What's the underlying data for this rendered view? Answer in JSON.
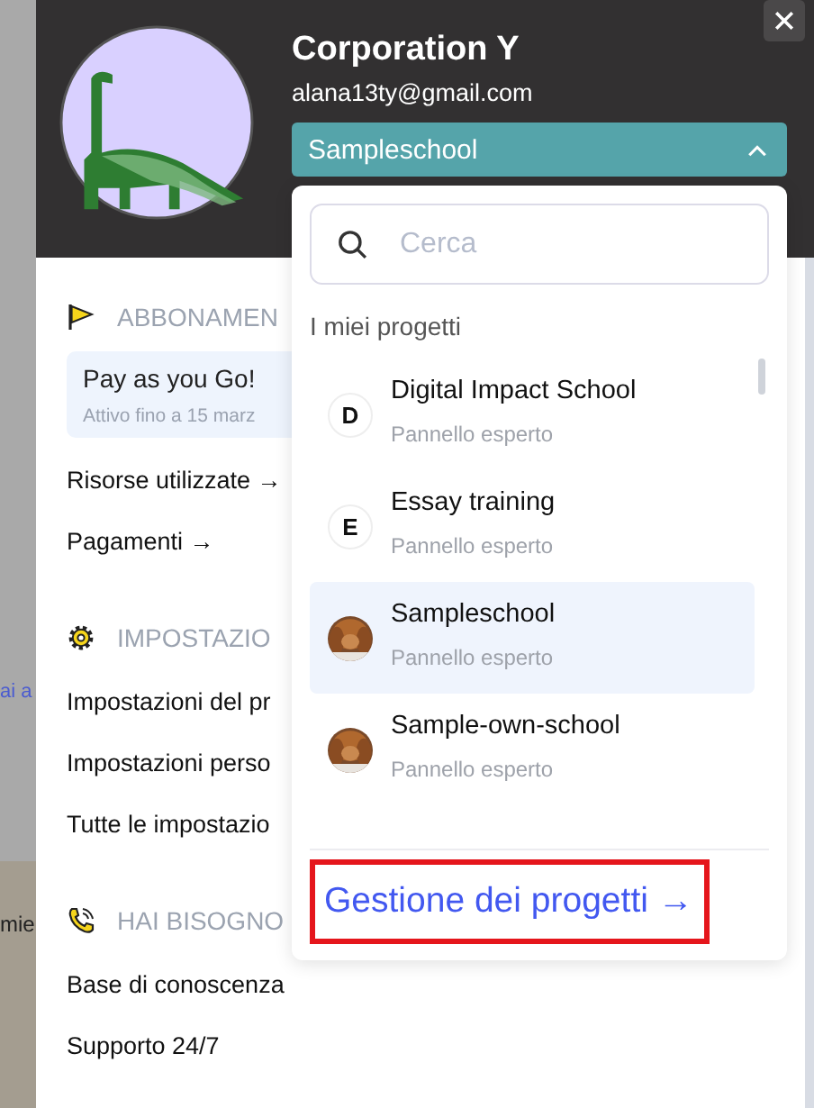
{
  "backdrop": {
    "texts": [
      "ai a",
      "mie"
    ]
  },
  "profile": {
    "name": "Corporation Y",
    "email": "alana13ty@gmail.com",
    "project_select": {
      "value": "Sampleschool",
      "expanded": true
    }
  },
  "sections": [
    {
      "title": "ABBONAMEN",
      "items": [
        {
          "kind": "plan",
          "title": "Pay as you Go!",
          "subtitle": "Attivo fino a 15 marz"
        },
        {
          "kind": "link",
          "label": "Risorse utilizzate →"
        },
        {
          "kind": "link",
          "label": "Pagamenti →"
        }
      ]
    },
    {
      "title": "IMPOSTAZIO",
      "items": [
        {
          "kind": "link",
          "label": "Impostazioni del pr"
        },
        {
          "kind": "link",
          "label": "Impostazioni perso"
        },
        {
          "kind": "link",
          "label": "Tutte le impostazio"
        }
      ]
    },
    {
      "title": "HAI BISOGNO",
      "items": [
        {
          "kind": "link",
          "label": "Base di conoscenza"
        },
        {
          "kind": "link",
          "label": "Supporto 24/7"
        }
      ]
    }
  ],
  "project_menu": {
    "search": {
      "placeholder": "Cerca"
    },
    "heading": "I miei progetti",
    "projects": [
      {
        "avatar": {
          "kind": "letter",
          "letter": "D"
        },
        "name": "Digital Impact School",
        "role": "Pannello esperto",
        "selected": false
      },
      {
        "avatar": {
          "kind": "letter",
          "letter": "E"
        },
        "name": "Essay training",
        "role": "Pannello esperto",
        "selected": false
      },
      {
        "name": "Sampleschool",
        "role": "Pannello esperto",
        "selected": true
      },
      {
        "name": "Sample-own-school",
        "role": "Pannello esperto",
        "selected": false
      }
    ],
    "manage_link": {
      "label": "Gestione dei progetti →",
      "highlighted": true
    }
  }
}
